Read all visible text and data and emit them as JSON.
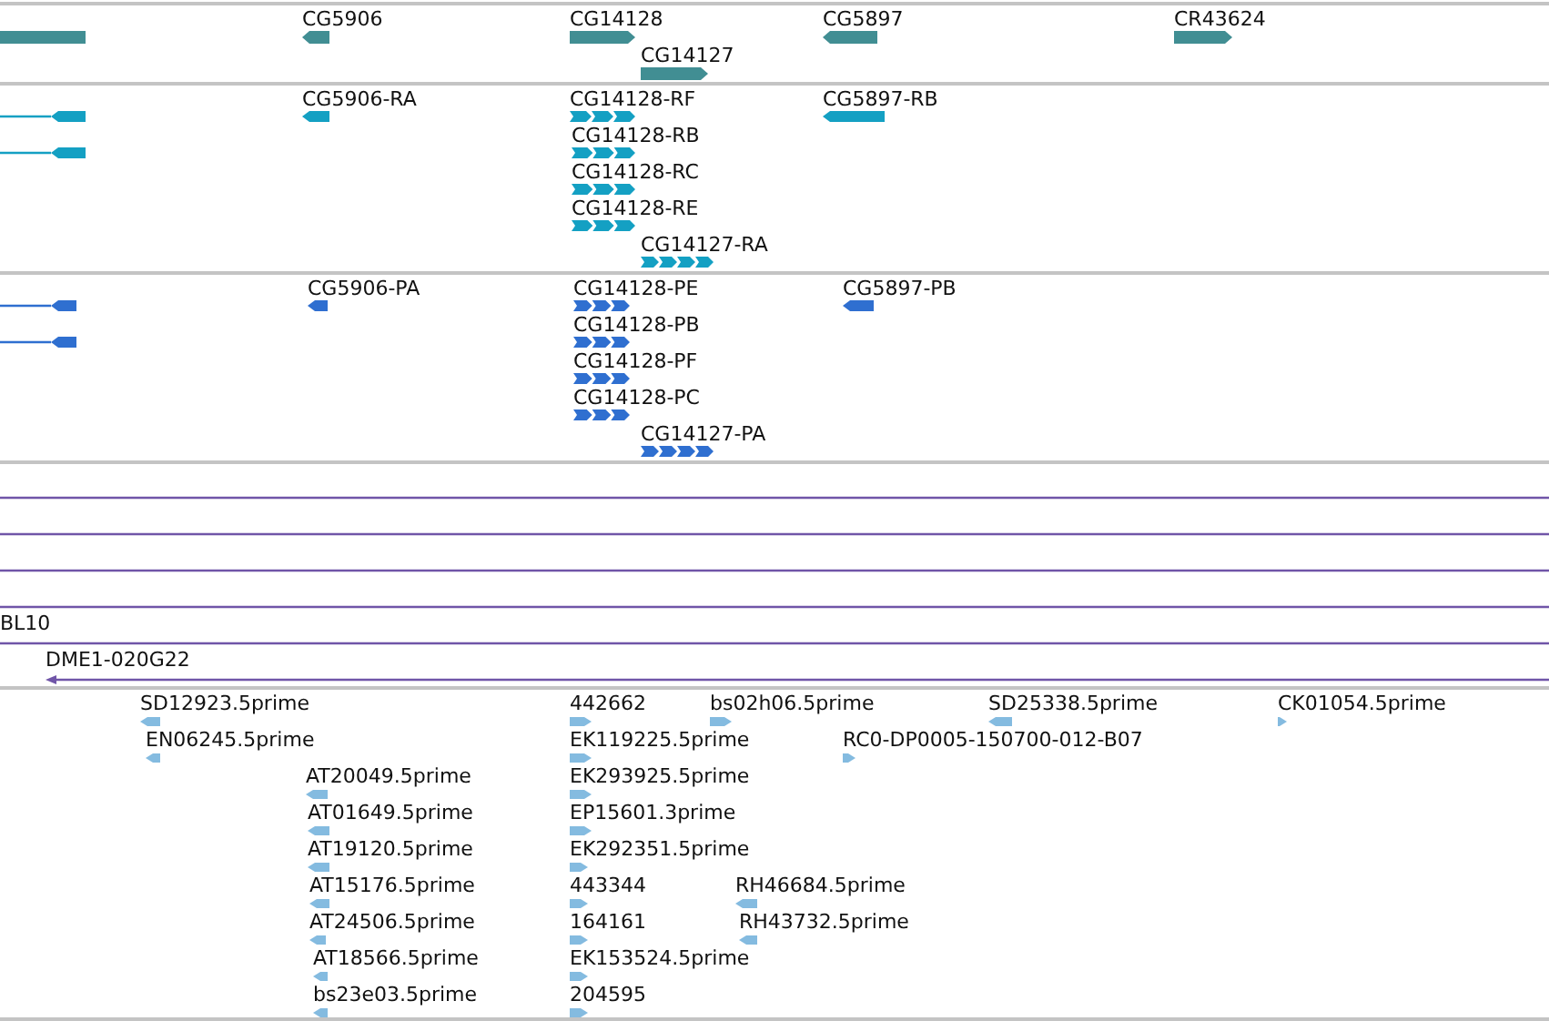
{
  "tracks": [
    {
      "kind": "gene",
      "features": [
        {
          "kind": "partial"
        },
        {
          "kind": "feature",
          "label": "CG5906",
          "reverse": true
        },
        {
          "kind": "feature",
          "label": "CG14128",
          "reverse": false
        },
        {
          "kind": "feature",
          "label": "CG5897",
          "reverse": true
        },
        {
          "kind": "feature",
          "label": "CR43624",
          "reverse": false
        },
        {
          "kind": "feature",
          "label": "CG14127",
          "reverse": false
        }
      ]
    },
    {
      "kind": "transcript",
      "features": [
        {
          "kind": "feature",
          "reverse": true
        },
        {
          "kind": "feature",
          "label": "CG5906-RA",
          "reverse": true
        },
        {
          "kind": "feature",
          "label": "CG14128-RF",
          "reverse": false
        },
        {
          "kind": "feature",
          "label": "CG5897-RB",
          "reverse": true
        },
        {
          "kind": "feature",
          "reverse": true
        },
        {
          "kind": "feature",
          "label": "CG14128-RB",
          "reverse": false
        },
        {
          "kind": "feature",
          "label": "CG14128-RC",
          "reverse": false
        },
        {
          "kind": "feature",
          "label": "CG14128-RE",
          "reverse": false
        },
        {
          "kind": "feature",
          "label": "CG14127-RA",
          "reverse": false
        }
      ]
    },
    {
      "kind": "protein",
      "features": [
        {
          "kind": "feature",
          "reverse": true
        },
        {
          "kind": "feature",
          "label": "CG5906-PA",
          "reverse": true
        },
        {
          "kind": "feature",
          "label": "CG14128-PE",
          "reverse": false
        },
        {
          "kind": "feature",
          "label": "CG5897-PB",
          "reverse": true
        },
        {
          "kind": "feature",
          "reverse": true
        },
        {
          "kind": "feature",
          "label": "CG14128-PB",
          "reverse": false
        },
        {
          "kind": "feature",
          "label": "CG14128-PF",
          "reverse": false
        },
        {
          "kind": "feature",
          "label": "CG14128-PC",
          "reverse": false
        },
        {
          "kind": "feature",
          "label": "CG14127-PA",
          "reverse": false
        }
      ]
    },
    {
      "kind": "clone",
      "features": [
        {
          "kind": "line",
          "reverse": false
        },
        {
          "kind": "line",
          "reverse": false
        },
        {
          "kind": "line",
          "reverse": false
        },
        {
          "kind": "line",
          "reverse": false
        },
        {
          "kind": "line",
          "label": "BL10",
          "reverse": false
        },
        {
          "kind": "line",
          "label": "DME1-020G22",
          "reverse": true
        }
      ]
    },
    {
      "kind": "est",
      "features": [
        {
          "kind": "feature",
          "label": "SD12923.5prime",
          "reverse": true
        },
        {
          "kind": "feature",
          "label": "442662",
          "reverse": false
        },
        {
          "kind": "feature",
          "label": "bs02h06.5prime",
          "reverse": false
        },
        {
          "kind": "feature",
          "label": "SD25338.5prime",
          "reverse": true
        },
        {
          "kind": "feature",
          "label": "CK01054.5prime",
          "reverse": false
        },
        {
          "kind": "feature",
          "label": "EN06245.5prime",
          "reverse": true
        },
        {
          "kind": "feature",
          "label": "EK119225.5prime",
          "reverse": false
        },
        {
          "kind": "feature",
          "label": "RC0-DP0005-150700-012-B07",
          "reverse": false
        },
        {
          "kind": "feature",
          "label": "AT20049.5prime",
          "reverse": true
        },
        {
          "kind": "feature",
          "label": "EK293925.5prime",
          "reverse": false
        },
        {
          "kind": "feature",
          "label": "AT01649.5prime",
          "reverse": true
        },
        {
          "kind": "feature",
          "label": "EP15601.3prime",
          "reverse": false
        },
        {
          "kind": "feature",
          "label": "AT19120.5prime",
          "reverse": true
        },
        {
          "kind": "feature",
          "label": "EK292351.5prime",
          "reverse": false
        },
        {
          "kind": "feature",
          "label": "AT15176.5prime",
          "reverse": true
        },
        {
          "kind": "feature",
          "label": "443344",
          "reverse": false
        },
        {
          "kind": "feature",
          "label": "RH46684.5prime",
          "reverse": true
        },
        {
          "kind": "feature",
          "label": "AT24506.5prime",
          "reverse": true
        },
        {
          "kind": "feature",
          "label": "164161",
          "reverse": false
        },
        {
          "kind": "feature",
          "label": "RH43732.5prime",
          "reverse": true
        },
        {
          "kind": "feature",
          "label": "AT18566.5prime",
          "reverse": true
        },
        {
          "kind": "feature",
          "label": "EK153524.5prime",
          "reverse": false
        },
        {
          "kind": "feature",
          "label": "bs23e03.5prime",
          "reverse": true
        },
        {
          "kind": "feature",
          "label": "204595",
          "reverse": false
        }
      ]
    }
  ]
}
